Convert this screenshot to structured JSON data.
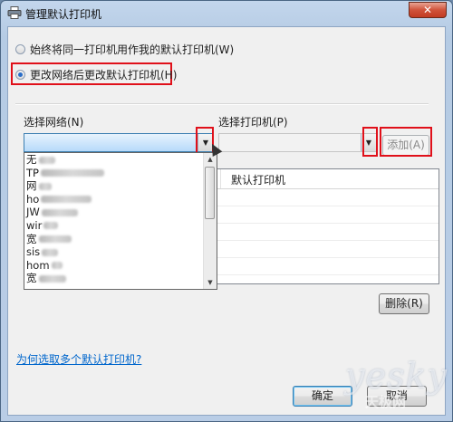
{
  "window": {
    "title": "管理默认打印机",
    "close_label": "✕"
  },
  "options": {
    "always_same": "始终将同一打印机用作我的默认打印机(W)",
    "change_with_network": "更改网络后更改默认打印机(H)",
    "selected": "change_with_network"
  },
  "network": {
    "label": "选择网络(N)",
    "items": [
      {
        "visible": "无",
        "hidden_w": 18
      },
      {
        "visible": "TP",
        "hidden_w": 70
      },
      {
        "visible": "网",
        "hidden_w": 14
      },
      {
        "visible": "ho",
        "hidden_w": 56
      },
      {
        "visible": "JW",
        "hidden_w": 40
      },
      {
        "visible": "wir",
        "hidden_w": 16
      },
      {
        "visible": "宽",
        "hidden_w": 36
      },
      {
        "visible": "sis",
        "hidden_w": 18
      },
      {
        "visible": "hom",
        "hidden_w": 12
      },
      {
        "visible": "宽",
        "hidden_w": 30
      }
    ]
  },
  "printer": {
    "label": "选择打印机(P)",
    "add_label": "添加(A)"
  },
  "table": {
    "col1": "",
    "col2": "默认打印机",
    "delete_label": "删除(R)"
  },
  "footer": {
    "help_link": "为何选取多个默认打印机?",
    "ok_label": "确定",
    "cancel_label": "取消"
  },
  "watermark": {
    "main": "yesky",
    "sub": "天极网"
  },
  "colors": {
    "highlight": "#e0101a",
    "link": "#0066cc"
  }
}
